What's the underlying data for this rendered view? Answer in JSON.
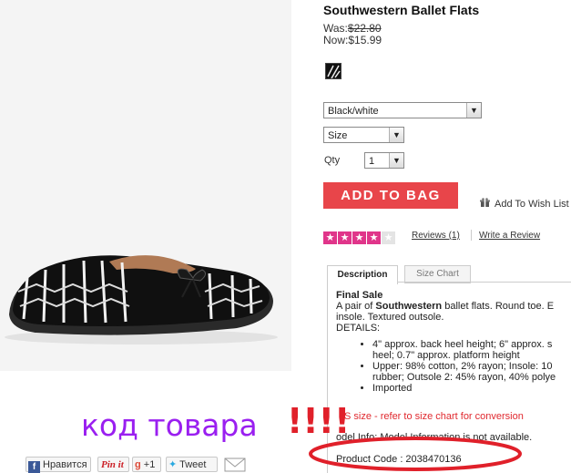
{
  "product": {
    "title": "Southwestern Ballet Flats",
    "was_label": "Was:",
    "was_price": "$22.80",
    "now_label": "Now:",
    "now_price": "$15.99"
  },
  "options": {
    "color": "Black/white",
    "size": "Size",
    "qty_label": "Qty",
    "qty": "1"
  },
  "actions": {
    "add_to_bag": "ADD TO BAG",
    "wishlist": "Add To Wish List"
  },
  "rating": {
    "stars_filled": 4,
    "stars_total": 5,
    "reviews": "Reviews (1)",
    "write_review": "Write a Review"
  },
  "tabs": [
    {
      "label": "Description",
      "active": true
    },
    {
      "label": "Size Chart",
      "active": false
    }
  ],
  "description": {
    "heading": "Final Sale",
    "line1_pre": "A pair of ",
    "line1_bold": "Southwestern",
    "line1_post": " ballet flats. Round toe. E",
    "line2": "insole. Textured outsole.",
    "line3": "DETAILS:",
    "bullets": [
      "4\" approx. back heel height; 6\" approx. s",
      "heel; 0.7\" approx. platform height",
      "Upper: 98% cotton, 2% rayon; Insole: 10",
      "rubber; Outsole 2: 45% rayon, 40% polye",
      "Imported"
    ],
    "size_note": "S size - refer to size chart for conversion",
    "model_info": "odel Info: Model Information is not available.",
    "product_code": "Product Code : 2038470136"
  },
  "annotation": {
    "text": "код товара",
    "exclaim": "!!!!",
    "color": "#9a1ff0",
    "exclaim_color": "#e0202a"
  },
  "social": {
    "facebook": "Нравится",
    "pinterest": "Pin it",
    "gplus": "+1",
    "tweet": "Tweet"
  },
  "colors": {
    "accent": "#e8454a",
    "stars": "#e0358a"
  }
}
